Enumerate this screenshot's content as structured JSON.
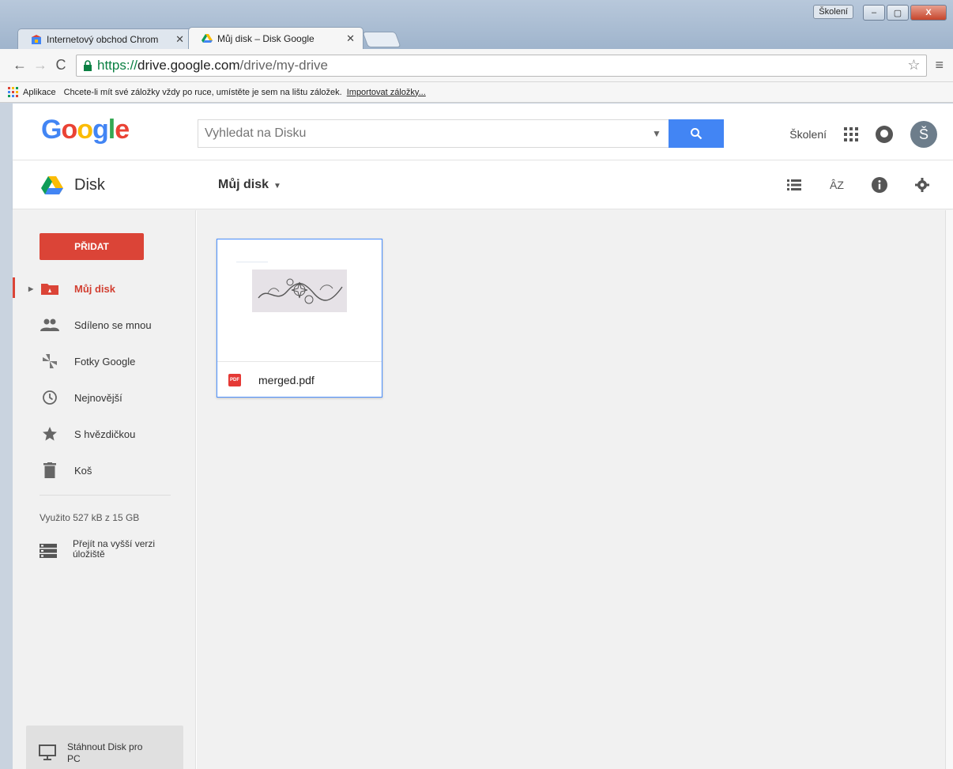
{
  "browser": {
    "tabs": [
      {
        "title": "Internetový obchod Chrom",
        "active": false
      },
      {
        "title": "Můj disk – Disk Google",
        "active": true
      }
    ],
    "profile_badge": "Školení",
    "window_buttons": {
      "minimize": "–",
      "maximize": "▢",
      "close": "X"
    },
    "url": {
      "scheme": "https://",
      "host": "drive.google.com",
      "path": "/drive/my-drive"
    },
    "bookmarks": {
      "apps_label": "Aplikace",
      "hint": "Chcete-li mít své záložky vždy po ruce, umístěte je sem na lištu záložek.",
      "import_link": "Importovat záložky..."
    }
  },
  "header": {
    "logo": "Google",
    "search_placeholder": "Vyhledat na Disku",
    "account_label": "Školení",
    "avatar_letter": "Š"
  },
  "subbar": {
    "product": "Disk",
    "location": "Můj disk",
    "caret": "▼"
  },
  "sidebar": {
    "new_button": "PŘIDAT",
    "items": [
      {
        "label": "Můj disk",
        "icon": "my-drive-icon",
        "active": true
      },
      {
        "label": "Sdíleno se mnou",
        "icon": "shared-people-icon",
        "active": false
      },
      {
        "label": "Fotky Google",
        "icon": "photos-pinwheel-icon",
        "active": false
      },
      {
        "label": "Nejnovější",
        "icon": "clock-icon",
        "active": false
      },
      {
        "label": "S hvězdičkou",
        "icon": "star-icon",
        "active": false
      },
      {
        "label": "Koš",
        "icon": "trash-icon",
        "active": false
      }
    ],
    "quota": "Využito 527 kB z 15 GB",
    "upgrade": "Přejít na vyšší verzi úložiště",
    "download": "Stáhnout Disk pro PC"
  },
  "files": [
    {
      "name": "merged.pdf",
      "type_badge": "PDF"
    }
  ],
  "colors": {
    "accent_red": "#db4437",
    "search_blue": "#4285f4",
    "selection_blue": "#4d90fe"
  }
}
